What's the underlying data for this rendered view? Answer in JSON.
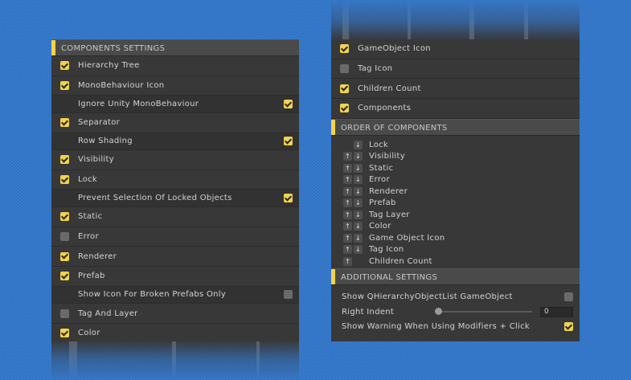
{
  "left": {
    "header": "COMPONENTS SETTINGS",
    "rows": [
      {
        "label": "Hierarchy Tree",
        "checked": true,
        "sub": false
      },
      {
        "label": "MonoBehaviour Icon",
        "checked": true,
        "sub": false
      },
      {
        "label": "Ignore Unity MonoBehaviour",
        "checked": true,
        "sub": true
      },
      {
        "label": "Separator",
        "checked": true,
        "sub": false
      },
      {
        "label": "Row Shading",
        "checked": true,
        "sub": true
      },
      {
        "label": "Visibility",
        "checked": true,
        "sub": false
      },
      {
        "label": "Lock",
        "checked": true,
        "sub": false
      },
      {
        "label": "Prevent Selection Of Locked Objects",
        "checked": true,
        "sub": true
      },
      {
        "label": "Static",
        "checked": true,
        "sub": false
      },
      {
        "label": "Error",
        "checked": false,
        "sub": false
      },
      {
        "label": "Renderer",
        "checked": true,
        "sub": false
      },
      {
        "label": "Prefab",
        "checked": true,
        "sub": false
      },
      {
        "label": "Show Icon For Broken Prefabs Only",
        "checked": false,
        "sub": true
      },
      {
        "label": "Tag And Layer",
        "checked": false,
        "sub": false
      },
      {
        "label": "Color",
        "checked": true,
        "sub": false
      }
    ]
  },
  "right": {
    "top_rows": [
      {
        "label": "GameObject Icon",
        "checked": true
      },
      {
        "label": "Tag Icon",
        "checked": false
      },
      {
        "label": "Children Count",
        "checked": true
      },
      {
        "label": "Components",
        "checked": true
      }
    ],
    "order_header": "ORDER OF COMPONENTS",
    "order": [
      {
        "label": "Lock",
        "up": false,
        "down": true
      },
      {
        "label": "Visibility",
        "up": true,
        "down": true
      },
      {
        "label": "Static",
        "up": true,
        "down": true
      },
      {
        "label": "Error",
        "up": true,
        "down": true
      },
      {
        "label": "Renderer",
        "up": true,
        "down": true
      },
      {
        "label": "Prefab",
        "up": true,
        "down": true
      },
      {
        "label": "Tag Layer",
        "up": true,
        "down": true
      },
      {
        "label": "Color",
        "up": true,
        "down": true
      },
      {
        "label": "Game Object Icon",
        "up": true,
        "down": true
      },
      {
        "label": "Tag Icon",
        "up": true,
        "down": true
      },
      {
        "label": "Children Count",
        "up": true,
        "down": false
      }
    ],
    "additional_header": "ADDITIONAL SETTINGS",
    "show_list_label": "Show QHierarchyObjectList GameObject",
    "show_list_checked": false,
    "right_indent_label": "Right Indent",
    "right_indent_value": "0",
    "right_indent_fraction": 0,
    "warning_label": "Show Warning When Using Modifiers + Click",
    "warning_checked": true
  },
  "icons": {
    "up": "up-arrow-icon",
    "down": "down-arrow-icon",
    "check": "checkmark-icon"
  },
  "colors": {
    "accent": "#f2d34c",
    "panel": "#383838",
    "background": "#2f73c6",
    "header": "#4a4a4a"
  }
}
